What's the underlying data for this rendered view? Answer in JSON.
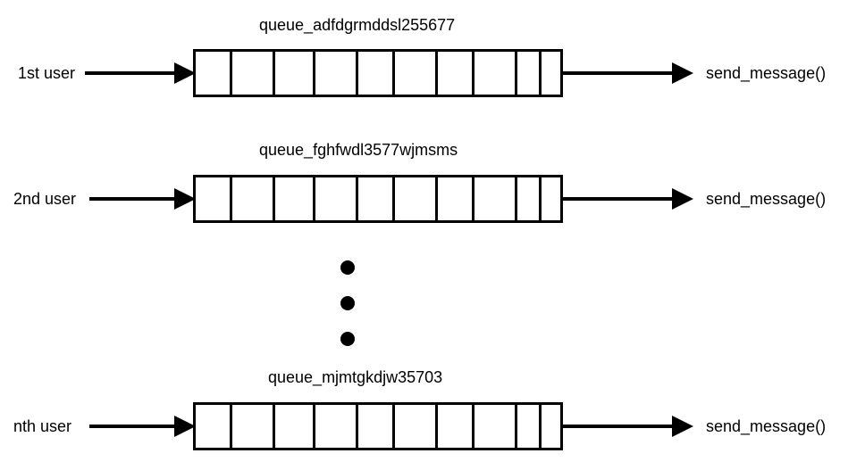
{
  "queues": [
    {
      "user_label": "1st user",
      "queue_name": "queue_adfdgrmddsl255677",
      "output_label": "send_message()"
    },
    {
      "user_label": "2nd user",
      "queue_name": "queue_fghfwdl3577wjmsms",
      "output_label": "send_message()"
    },
    {
      "user_label": "nth user",
      "queue_name": "queue_mjmtgkdjw35703",
      "output_label": "send_message()"
    }
  ]
}
